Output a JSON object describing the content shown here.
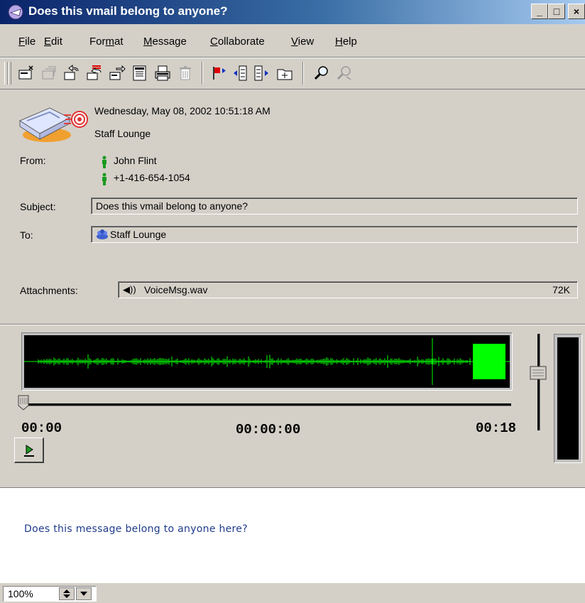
{
  "window": {
    "title": "Does this vmail belong to anyone?",
    "controls": [
      "_",
      "□",
      "×"
    ]
  },
  "menu": [
    {
      "label": "File",
      "key": "F",
      "rest": "ile"
    },
    {
      "label": "Edit",
      "key": "E",
      "rest": "dit"
    },
    {
      "label": "Format",
      "pre": "For",
      "key": "m",
      "rest": "at"
    },
    {
      "label": "Message",
      "key": "M",
      "rest": "essage"
    },
    {
      "label": "Collaborate",
      "key": "C",
      "rest": "ollaborate"
    },
    {
      "label": "View",
      "key": "V",
      "rest": "iew"
    },
    {
      "label": "Help",
      "key": "H",
      "rest": "elp"
    }
  ],
  "toolbar": {
    "icons": [
      "new-message-icon",
      "reply-disabled-icon",
      "reply-icon",
      "reply-all-icon",
      "forward-icon",
      "properties-icon",
      "print-icon",
      "delete-icon",
      "flag-icon",
      "previous-icon",
      "next-icon",
      "move-to-folder-icon",
      "find-icon",
      "find-next-icon"
    ]
  },
  "header": {
    "date": "Wednesday, May 08, 2002 10:51:18 AM",
    "location": "Staff Lounge",
    "from_label": "From:",
    "from_name": "John Flint",
    "from_phone": "+1-416-654-1054",
    "subject_label": "Subject:",
    "subject": "Does this vmail belong to anyone?",
    "to_label": "To:",
    "to": "Staff Lounge",
    "attachments_label": "Attachments:",
    "attachment_name": "VoiceMsg.wav",
    "attachment_size": "72K"
  },
  "player": {
    "start_time": "00:00",
    "current_time": "00:00:00",
    "end_time": "00:18",
    "position": 0,
    "volume": 0.65
  },
  "message": {
    "body": "Does this message belong to anyone here?"
  },
  "status": {
    "zoom": "100%"
  },
  "colors": {
    "title_start": "#0a246a",
    "waveform": "#00ff00",
    "body_text": "#1f3c8c"
  }
}
